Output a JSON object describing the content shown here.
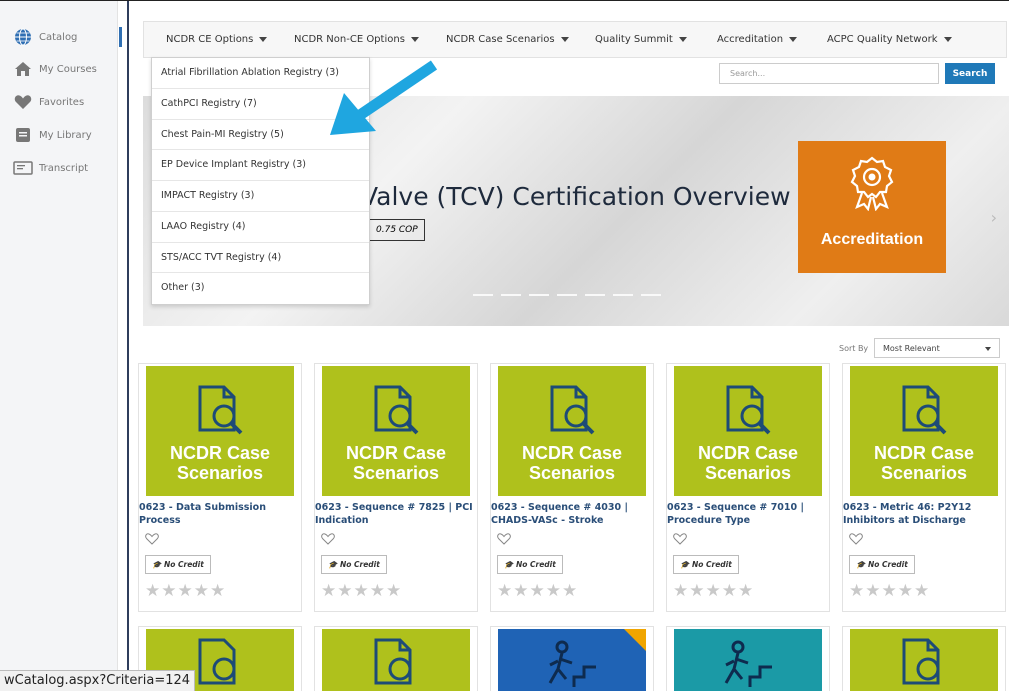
{
  "sidebar": {
    "items": [
      {
        "label": "Catalog",
        "icon": "globe-icon"
      },
      {
        "label": "My Courses",
        "icon": "home-icon"
      },
      {
        "label": "Favorites",
        "icon": "heart-icon"
      },
      {
        "label": "My Library",
        "icon": "library-icon"
      },
      {
        "label": "Transcript",
        "icon": "transcript-icon"
      }
    ]
  },
  "nav": {
    "items": [
      "NCDR CE Options",
      "NCDR Non-CE Options",
      "NCDR Case Scenarios",
      "Quality Summit",
      "Accreditation",
      "ACPC Quality Network"
    ]
  },
  "dropdown": {
    "items": [
      "Atrial Fibrillation Ablation Registry (3)",
      "CathPCI Registry (7)",
      "Chest Pain-MI Registry (5)",
      "EP Device Implant Registry (3)",
      "IMPACT Registry (3)",
      "LAAO Registry (4)",
      "STS/ACC TVT Registry (4)",
      "Other (3)"
    ]
  },
  "search": {
    "placeholder": "Search...",
    "button": "Search"
  },
  "hero": {
    "title": "Valve (TCV) Certification Overview",
    "badge": "0.75 COP",
    "accreditation_label": "Accreditation"
  },
  "sort": {
    "label": "Sort By",
    "value": "Most Relevant"
  },
  "cards": [
    {
      "thumb_text1": "NCDR Case",
      "thumb_text2": "Scenarios",
      "title": "0623 - Data Submission Process",
      "credit": "No Credit"
    },
    {
      "thumb_text1": "NCDR Case",
      "thumb_text2": "Scenarios",
      "title": "0623 - Sequence # 7825 | PCI Indication",
      "credit": "No Credit"
    },
    {
      "thumb_text1": "NCDR Case",
      "thumb_text2": "Scenarios",
      "title": "0623 - Sequence # 4030 | CHADS-VASc - Stroke",
      "credit": "No Credit"
    },
    {
      "thumb_text1": "NCDR Case",
      "thumb_text2": "Scenarios",
      "title": "0623 - Sequence # 7010 | Procedure Type",
      "credit": "No Credit"
    },
    {
      "thumb_text1": "NCDR Case",
      "thumb_text2": "Scenarios",
      "title": "0623 - Metric 46: P2Y12 Inhibitors at Discharge",
      "credit": "No Credit"
    }
  ],
  "stars": "★★★★★",
  "status_url": "wCatalog.aspx?Criteria=124",
  "colors": {
    "accent": "#1f79b8",
    "card_green": "#afc11c",
    "accreditation": "#e07b16",
    "arrow": "#1fa6e0"
  }
}
